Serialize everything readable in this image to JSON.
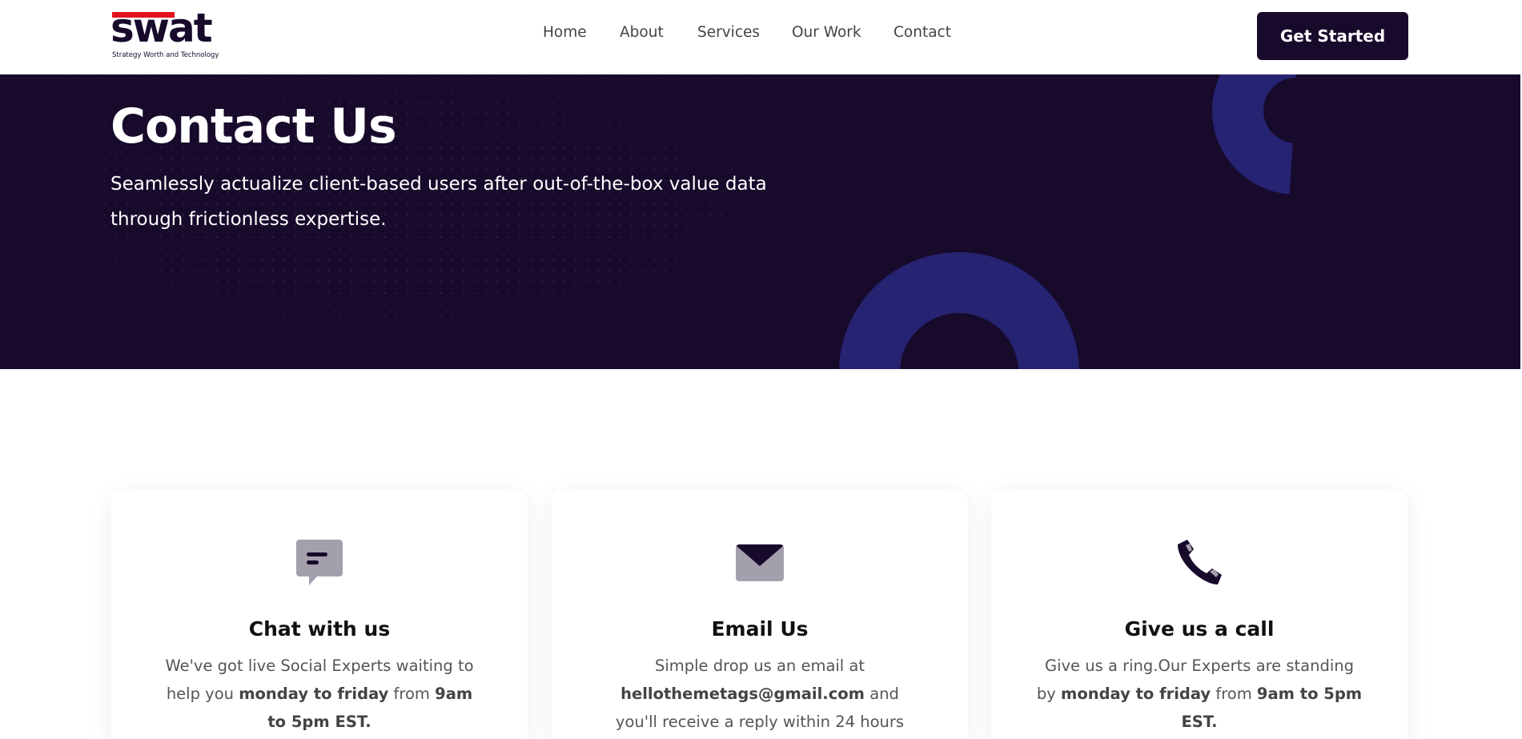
{
  "header": {
    "logo_word": "swat",
    "logo_tagline": "Strategy Worth and Technology",
    "nav": [
      "Home",
      "About",
      "Services",
      "Our Work",
      "Contact"
    ],
    "cta_label": "Get Started"
  },
  "hero": {
    "title": "Contact Us",
    "subtitle": "Seamlessly actualize client-based users after out-of-the-box value data through frictionless expertise."
  },
  "cards": [
    {
      "icon": "chat-icon",
      "title": "Chat with us",
      "text_parts": [
        "We've got live Social Experts waiting to help you ",
        "monday to friday",
        " from ",
        "9am to 5pm EST."
      ]
    },
    {
      "icon": "envelope-icon",
      "title": "Email Us",
      "text_parts": [
        "Simple drop us an email at ",
        "hellothemetags@gmail.com",
        " and you'll receive a reply within 24 hours"
      ]
    },
    {
      "icon": "phone-icon",
      "title": "Give us a call",
      "text_parts": [
        "Give us a ring.Our Experts are standing by ",
        "monday to friday",
        " from ",
        "9am to 5pm EST."
      ]
    }
  ],
  "colors": {
    "brand_dark": "#170a2b",
    "accent_ring": "#262372",
    "logo_red": "#e3121f",
    "icon_muted": "#a49fad"
  }
}
